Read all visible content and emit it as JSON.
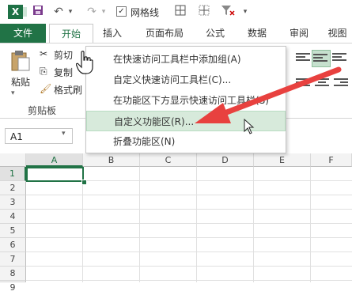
{
  "qat": {
    "logo": "X",
    "gridlines_checked": "✓",
    "gridlines_label": "网格线"
  },
  "tabs": [
    "文件",
    "开始",
    "插入",
    "页面布局",
    "公式",
    "数据",
    "审阅",
    "视图"
  ],
  "ribbon": {
    "cut_label": "剪切",
    "copy_label": "复制",
    "format_painter_label": "格式刷",
    "paste_label": "粘贴",
    "clipboard_group_label": "剪贴板"
  },
  "context_menu": {
    "items": [
      "在快速访问工具栏中添加组(A)",
      "自定义快速访问工具栏(C)...",
      "在功能区下方显示快速访问工具栏(S)",
      "自定义功能区(R)...",
      "折叠功能区(N)"
    ],
    "highlighted_index": 3
  },
  "formula_bar": {
    "name_box": "A1"
  },
  "grid": {
    "columns": [
      "A",
      "B",
      "C",
      "D",
      "E",
      "F"
    ],
    "rows": [
      "1",
      "2",
      "3",
      "4",
      "5",
      "6",
      "7",
      "8",
      "9"
    ]
  },
  "colors": {
    "accent": "#217346",
    "arrow": "#e8413f",
    "menu_highlight": "#d7eadb"
  }
}
